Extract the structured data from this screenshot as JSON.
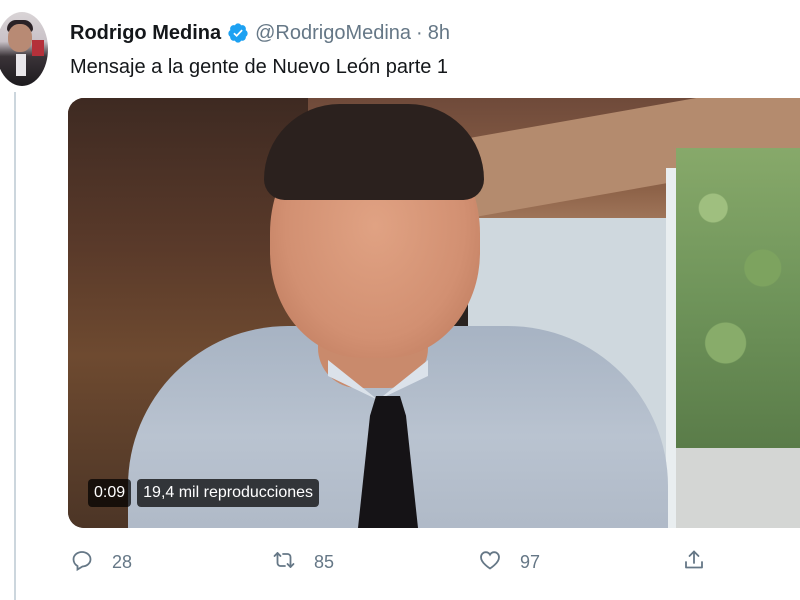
{
  "tweet": {
    "author_name": "Rodrigo Medina",
    "author_handle": "@RodrigoMedina",
    "separator": "·",
    "time": "8h",
    "verified": true,
    "text": "Mensaje a la gente de Nuevo León parte 1"
  },
  "video": {
    "elapsed": "0:09",
    "views": "19,4 mil reproducciones"
  },
  "actions": {
    "reply_count": "28",
    "retweet_count": "85",
    "like_count": "97"
  },
  "icons": {
    "verified": "verified-badge-icon",
    "reply": "reply-icon",
    "retweet": "retweet-icon",
    "like": "heart-icon",
    "share": "share-icon"
  },
  "colors": {
    "verified": "#1da1f2",
    "secondary_text": "#657786",
    "primary_text": "#14171a"
  }
}
